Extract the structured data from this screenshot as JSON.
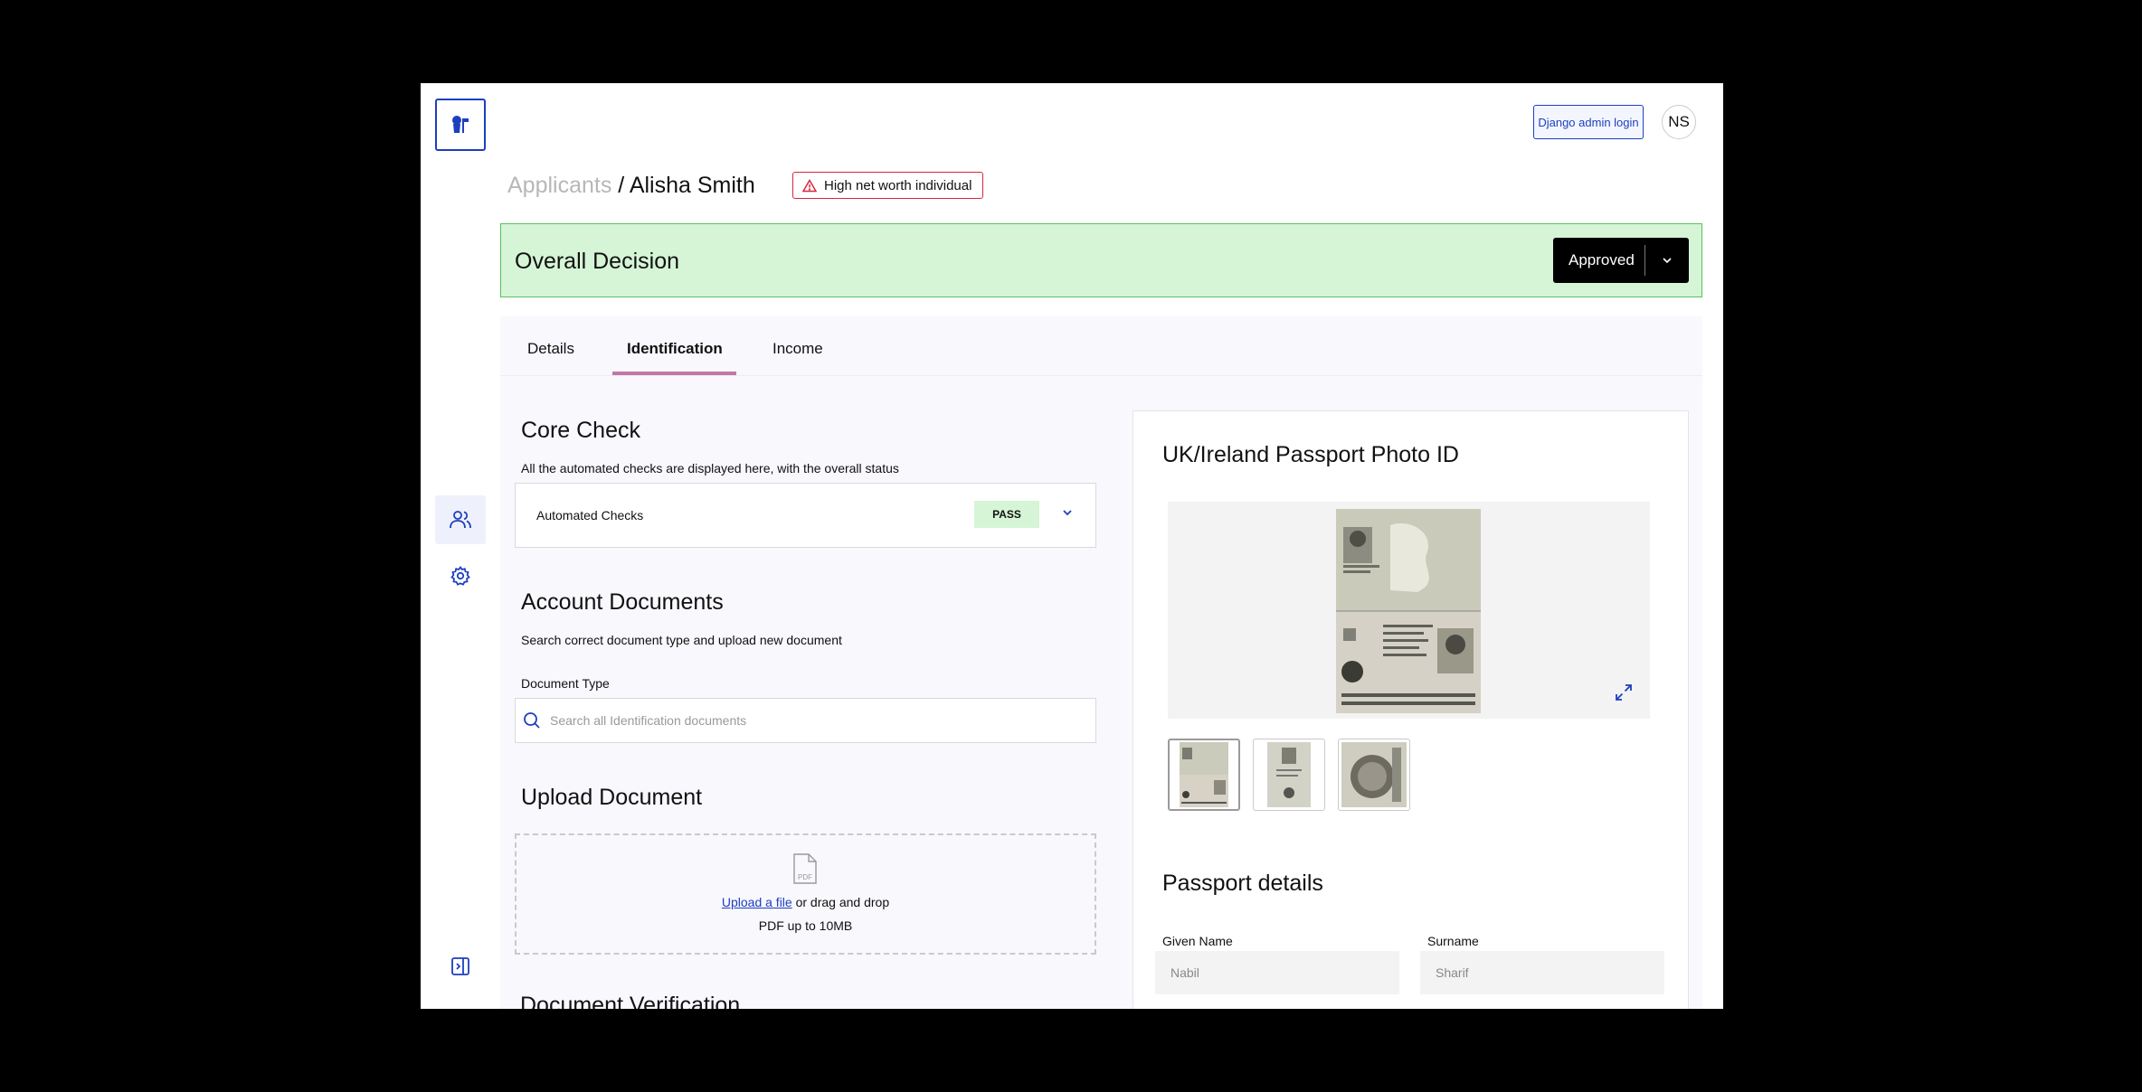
{
  "header": {
    "admin_button_label": "Django admin login",
    "avatar_initials": "NS"
  },
  "breadcrumb": {
    "root": "Applicants",
    "separator": " / ",
    "current": "Alisha Smith"
  },
  "flag": {
    "label": "High net worth individual",
    "icon": "warning-triangle-icon"
  },
  "decision": {
    "title": "Overall Decision",
    "selected_value": "Approved"
  },
  "tabs": [
    {
      "label": "Details",
      "active": false
    },
    {
      "label": "Identification",
      "active": true
    },
    {
      "label": "Income",
      "active": false
    }
  ],
  "core_check": {
    "title": "Core Check",
    "description": "All the automated checks are displayed here, with the overall status",
    "row_label": "Automated Checks",
    "status": "PASS"
  },
  "account_documents": {
    "title": "Account Documents",
    "description": "Search correct document type and upload new document",
    "field_label": "Document Type",
    "search_placeholder": "Search all Identification documents"
  },
  "upload": {
    "title": "Upload Document",
    "link_text": "Upload a file",
    "rest_text": " or drag and drop",
    "hint": "PDF up to 10MB",
    "icon_label": "PDF"
  },
  "next_section_title": "Document Verification",
  "passport": {
    "title": "UK/Ireland Passport Photo ID",
    "details_title": "Passport details",
    "given_name_label": "Given Name",
    "given_name_value": "Nabil",
    "surname_label": "Surname",
    "surname_value": "Sharif",
    "thumbnail_count": 3
  },
  "colors": {
    "accent_blue": "#1d3fbf",
    "decision_bg": "#d5f5d6",
    "decision_border": "#56c25d",
    "tab_underline": "#c277a6",
    "flag_red": "#d7263d"
  }
}
